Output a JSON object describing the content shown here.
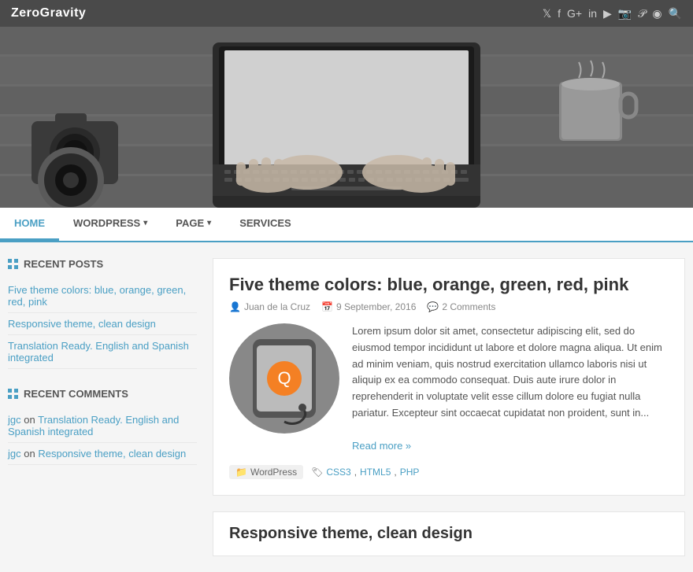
{
  "header": {
    "site_title": "ZeroGravity",
    "social_icons": [
      "twitter",
      "facebook",
      "google-plus",
      "linkedin",
      "youtube",
      "instagram",
      "pinterest",
      "rss",
      "search"
    ]
  },
  "nav": {
    "items": [
      {
        "label": "HOME",
        "active": true,
        "has_arrow": false
      },
      {
        "label": "WORDPRESS",
        "active": false,
        "has_arrow": true
      },
      {
        "label": "PAGE",
        "active": false,
        "has_arrow": true
      },
      {
        "label": "SERVICES",
        "active": false,
        "has_arrow": false
      }
    ]
  },
  "sidebar": {
    "recent_posts_title": "RECENT POSTS",
    "recent_posts": [
      {
        "label": "Five theme colors: blue, orange, green, red, pink"
      },
      {
        "label": "Responsive theme, clean design"
      },
      {
        "label": "Translation Ready. English and Spanish integrated"
      }
    ],
    "recent_comments_title": "RECENT COMMENTS",
    "recent_comments": [
      {
        "user": "jgc",
        "on": "on",
        "post": "Translation Ready. English and Spanish integrated"
      },
      {
        "user": "jgc",
        "on": "on",
        "post": "Responsive theme, clean design"
      }
    ]
  },
  "posts": [
    {
      "title": "Five theme colors: blue, orange, green, red, pink",
      "author": "Juan de la Cruz",
      "date": "9 September, 2016",
      "comments": "2 Comments",
      "excerpt": "Lorem ipsum dolor sit amet, consectetur adipiscing elit, sed do eiusmod tempor incididunt ut labore et dolore magna aliqua. Ut enim ad minim veniam, quis nostrud exercitation ullamco laboris nisi ut aliquip ex ea commodo consequat. Duis aute irure dolor in reprehenderit in voluptate velit esse cillum dolore eu fugiat nulla pariatur. Excepteur sint occaecat cupidatat non proident, sunt in...",
      "read_more": "Read more »",
      "category": "WordPress",
      "tags": [
        "CSS3",
        "HTML5",
        "PHP"
      ]
    },
    {
      "title": "Responsive theme, clean design"
    }
  ]
}
